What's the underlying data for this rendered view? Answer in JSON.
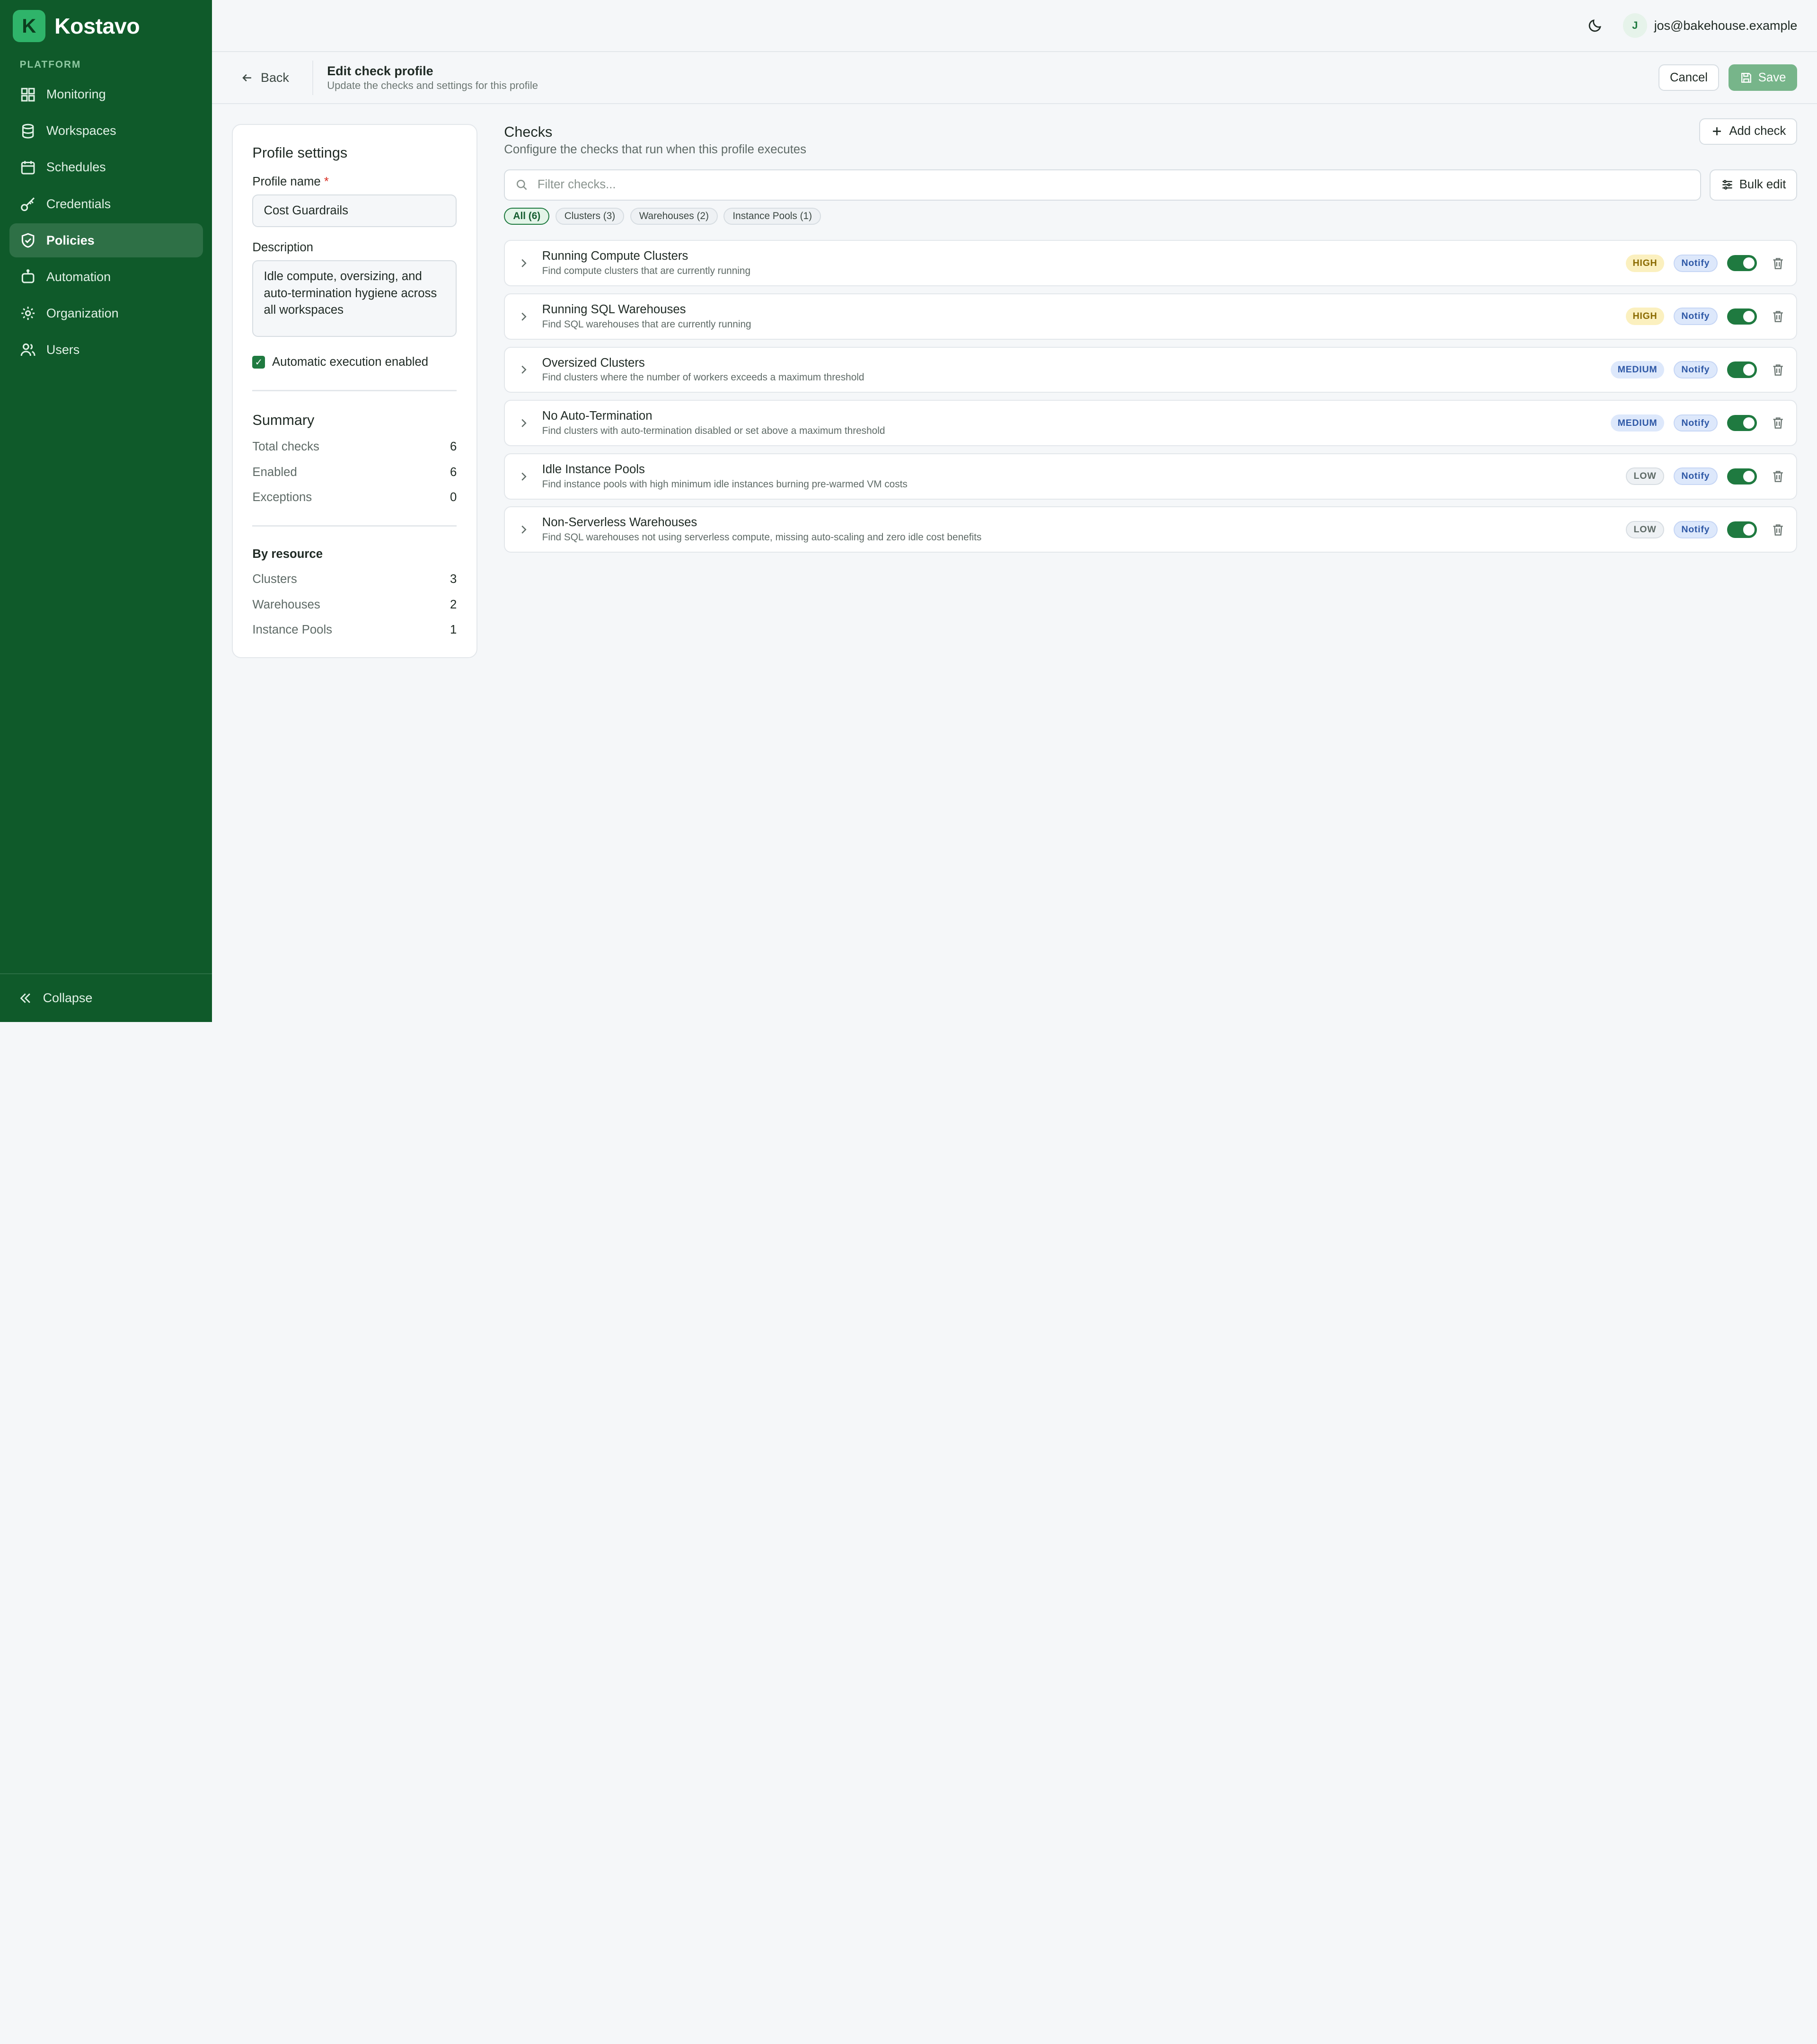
{
  "app": {
    "name": "Kostavo",
    "logo_letter": "K"
  },
  "sidebar": {
    "section_label": "PLATFORM",
    "items": [
      {
        "label": "Monitoring",
        "icon": "grid-icon"
      },
      {
        "label": "Workspaces",
        "icon": "database-icon"
      },
      {
        "label": "Schedules",
        "icon": "calendar-icon"
      },
      {
        "label": "Credentials",
        "icon": "key-icon"
      },
      {
        "label": "Policies",
        "icon": "shield-icon",
        "active": true
      },
      {
        "label": "Automation",
        "icon": "robot-icon"
      },
      {
        "label": "Organization",
        "icon": "gear-icon"
      },
      {
        "label": "Users",
        "icon": "users-icon"
      }
    ],
    "collapse_label": "Collapse"
  },
  "topbar": {
    "user_initial": "J",
    "user_email": "jos@bakehouse.example"
  },
  "subbar": {
    "back_label": "Back",
    "title": "Edit check profile",
    "subtitle": "Update the checks and settings for this profile",
    "cancel_label": "Cancel",
    "save_label": "Save"
  },
  "profile": {
    "card_title": "Profile settings",
    "name_label": "Profile name",
    "required_mark": "*",
    "name_value": "Cost Guardrails",
    "description_label": "Description",
    "description_value": "Idle compute, oversizing, and auto-termination hygiene across all workspaces",
    "auto_exec_label": "Automatic execution enabled",
    "auto_exec_checked": true
  },
  "summary": {
    "title": "Summary",
    "rows": [
      {
        "label": "Total checks",
        "value": "6"
      },
      {
        "label": "Enabled",
        "value": "6"
      },
      {
        "label": "Exceptions",
        "value": "0"
      }
    ],
    "by_resource_title": "By resource",
    "resources": [
      {
        "label": "Clusters",
        "value": "3"
      },
      {
        "label": "Warehouses",
        "value": "2"
      },
      {
        "label": "Instance Pools",
        "value": "1"
      }
    ]
  },
  "checks": {
    "title": "Checks",
    "subtitle": "Configure the checks that run when this profile executes",
    "add_label": "Add check",
    "search_placeholder": "Filter checks...",
    "bulk_label": "Bulk edit",
    "filters": [
      {
        "label": "All (6)",
        "active": true
      },
      {
        "label": "Clusters (3)"
      },
      {
        "label": "Warehouses (2)"
      },
      {
        "label": "Instance Pools (1)"
      }
    ],
    "items": [
      {
        "title": "Running Compute Clusters",
        "desc": "Find compute clusters that are currently running",
        "severity": "HIGH",
        "action": "Notify",
        "enabled": true
      },
      {
        "title": "Running SQL Warehouses",
        "desc": "Find SQL warehouses that are currently running",
        "severity": "HIGH",
        "action": "Notify",
        "enabled": true
      },
      {
        "title": "Oversized Clusters",
        "desc": "Find clusters where the number of workers exceeds a maximum threshold",
        "severity": "MEDIUM",
        "action": "Notify",
        "enabled": true
      },
      {
        "title": "No Auto-Termination",
        "desc": "Find clusters with auto-termination disabled or set above a maximum threshold",
        "severity": "MEDIUM",
        "action": "Notify",
        "enabled": true
      },
      {
        "title": "Idle Instance Pools",
        "desc": "Find instance pools with high minimum idle instances burning pre-warmed VM costs",
        "severity": "LOW",
        "action": "Notify",
        "enabled": true
      },
      {
        "title": "Non-Serverless Warehouses",
        "desc": "Find SQL warehouses not using serverless compute, missing auto-scaling and zero idle cost benefits",
        "severity": "LOW",
        "action": "Notify",
        "enabled": true
      }
    ]
  },
  "colors": {
    "sidebar_bg": "#0f5a2a",
    "accent": "#1f7a40",
    "save_disabled": "#77b58a"
  }
}
